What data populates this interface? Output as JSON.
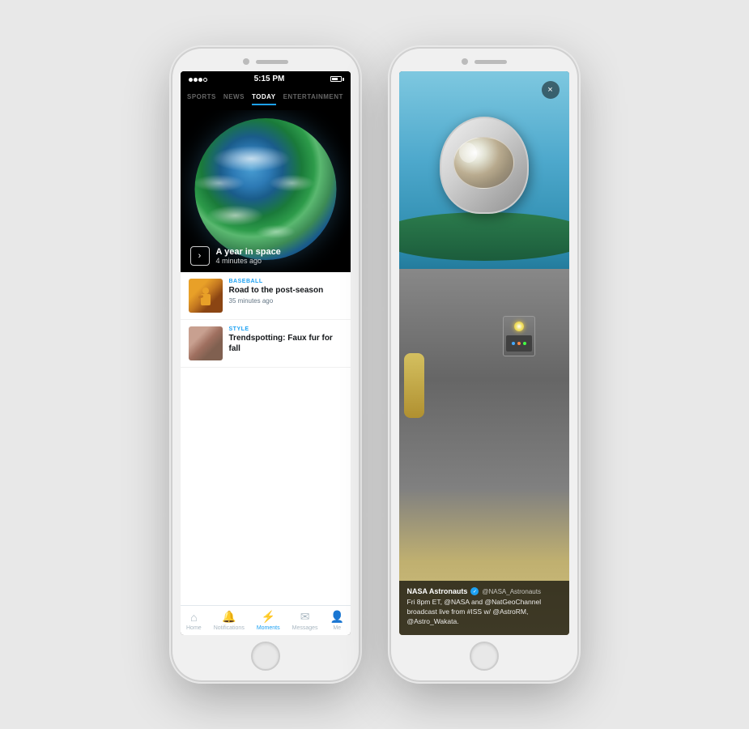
{
  "leftPhone": {
    "statusBar": {
      "dots": 4,
      "time": "5:15 PM",
      "batteryLabel": ""
    },
    "tabs": [
      {
        "label": "SPORTS",
        "active": false
      },
      {
        "label": "NEWS",
        "active": false
      },
      {
        "label": "TODAY",
        "active": true
      },
      {
        "label": "ENTERTAINMENT",
        "active": false
      }
    ],
    "hero": {
      "title": "A year in space",
      "timeAgo": "4 minutes ago"
    },
    "feedItems": [
      {
        "category": "BASEBALL",
        "headline": "Road to the post-season",
        "timeAgo": "35 minutes ago"
      },
      {
        "category": "STYLE",
        "headline": "Trendspotting: Faux fur for fall",
        "timeAgo": ""
      }
    ],
    "navItems": [
      {
        "icon": "🏠",
        "label": "Home",
        "active": false
      },
      {
        "icon": "🔔",
        "label": "Notifications",
        "active": false
      },
      {
        "icon": "⚡",
        "label": "Moments",
        "active": true
      },
      {
        "icon": "✉",
        "label": "Messages",
        "active": false
      },
      {
        "icon": "👤",
        "label": "Me",
        "active": false
      }
    ]
  },
  "rightPhone": {
    "tweet": {
      "name": "NASA Astronauts",
      "handle": "@NASA_Astronauts",
      "verified": true,
      "text": "Fri 8pm ET, @NASA and @NatGeoChannel broadcast live from #ISS w/ @AstroRM, @Astro_Wakata."
    },
    "closeButton": "×"
  }
}
